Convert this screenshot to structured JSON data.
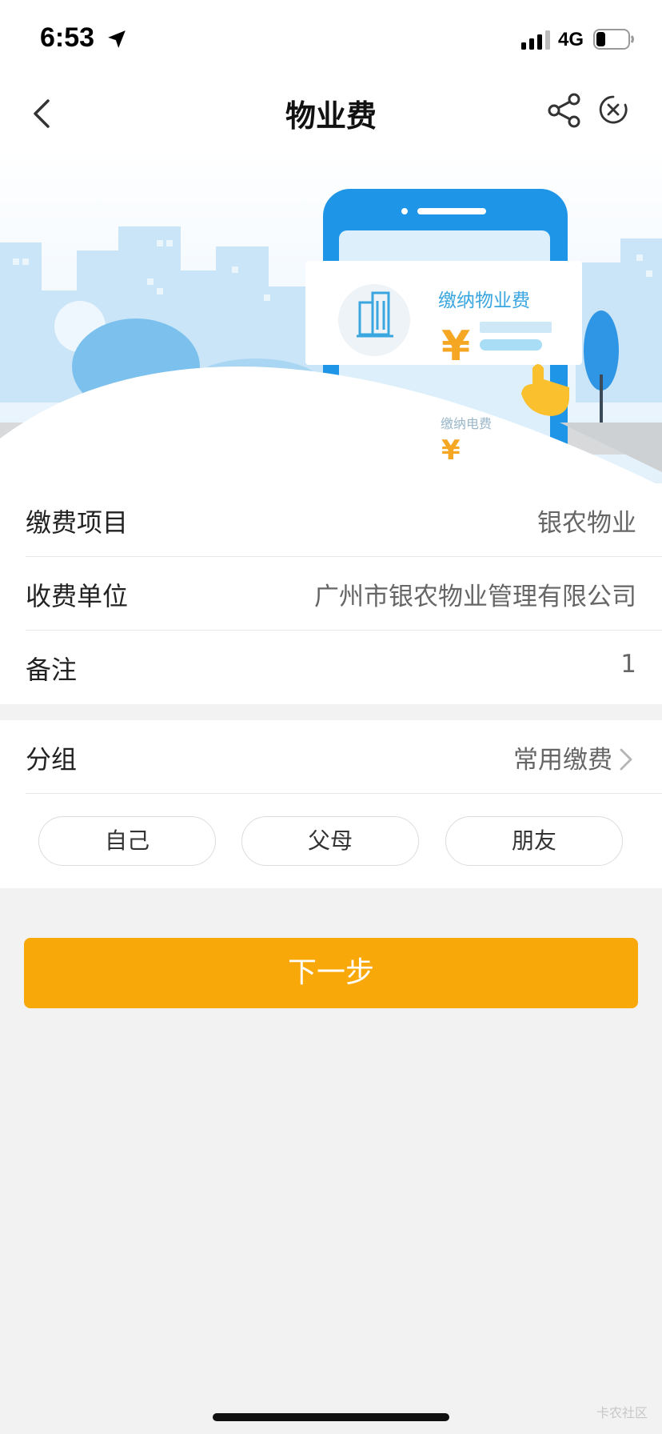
{
  "status_bar": {
    "time": "6:53",
    "network": "4G",
    "icons": [
      "location-arrow-icon",
      "signal-icon",
      "battery-icon"
    ]
  },
  "nav": {
    "title": "物业费",
    "icons": [
      "back-icon",
      "share-icon",
      "close-icon"
    ]
  },
  "banner": {
    "card_title": "缴纳物业费",
    "card_currency": "¥",
    "secondary_title": "缴纳电费",
    "secondary_currency": "¥"
  },
  "info": {
    "rows": [
      {
        "label": "缴费项目",
        "value": "银农物业"
      },
      {
        "label": "收费单位",
        "value": "广州市银农物业管理有限公司"
      },
      {
        "label": "备注",
        "value": "1"
      }
    ]
  },
  "group": {
    "label": "分组",
    "value": "常用缴费",
    "chips": [
      "自己",
      "父母",
      "朋友"
    ]
  },
  "next_button": {
    "label": "下一步"
  },
  "watermark": "卡农社区",
  "colors": {
    "accent": "#f9a80a",
    "banner_blue": "#3aa6e0",
    "page_bg": "#f2f2f2"
  }
}
